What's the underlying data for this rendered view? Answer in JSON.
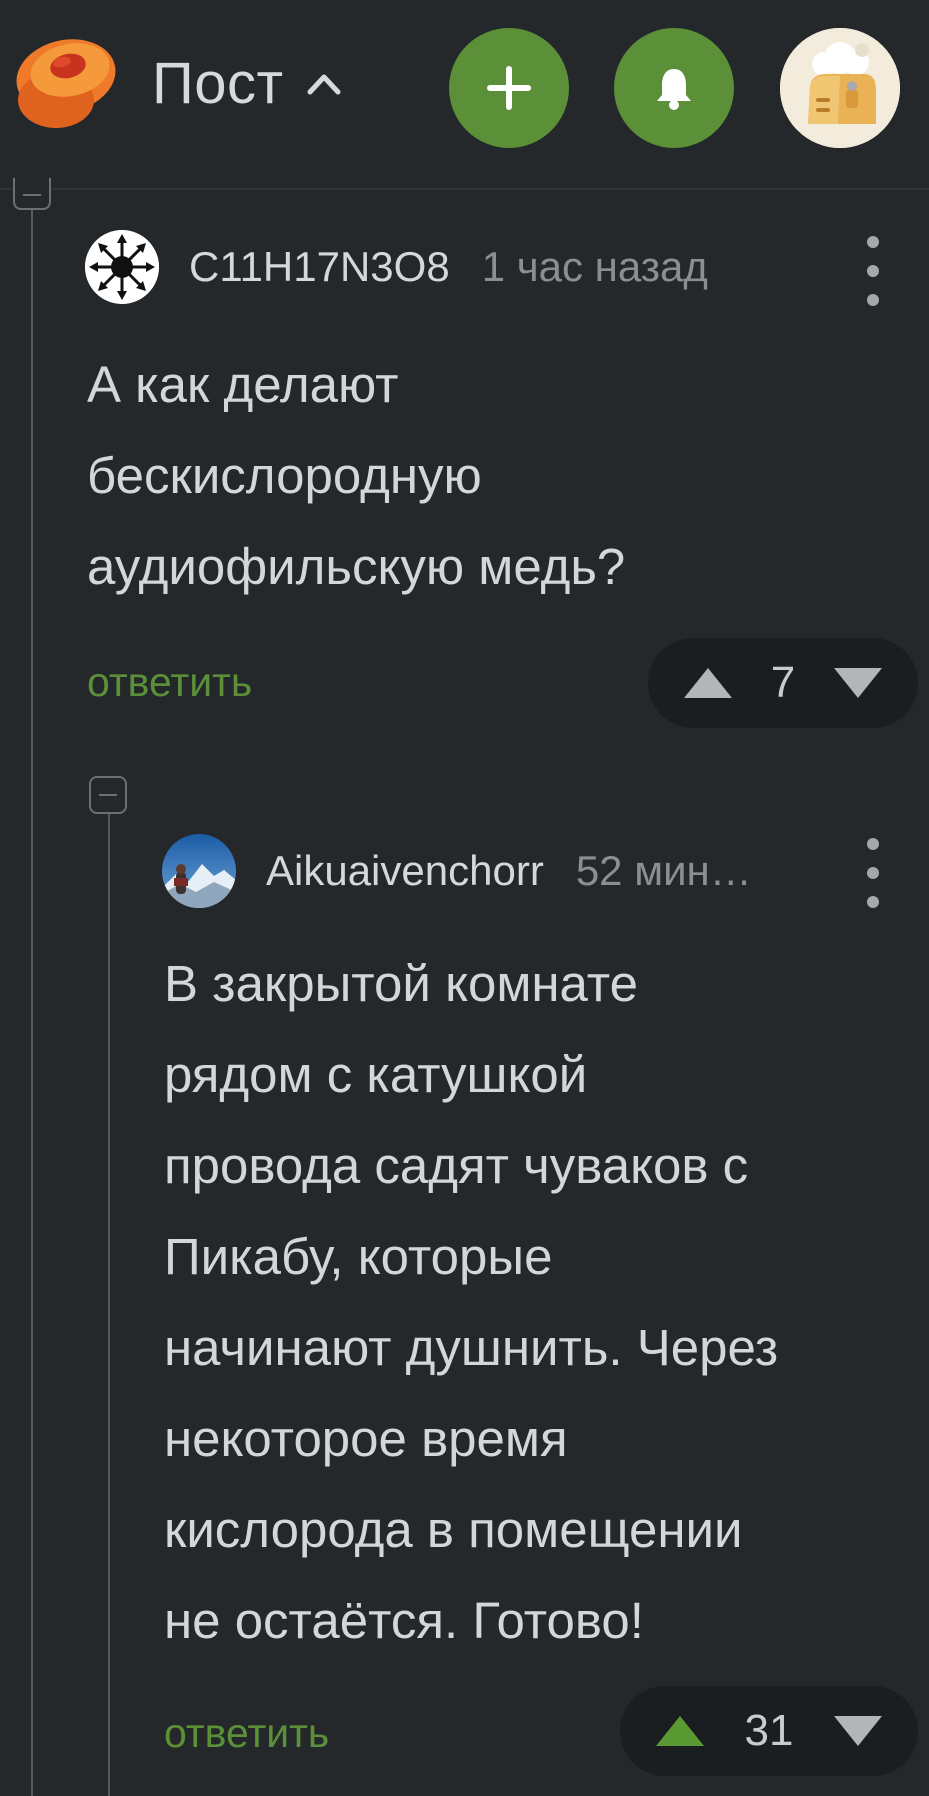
{
  "header": {
    "title": "Пост",
    "add_label": "add",
    "colors": {
      "background": "#24282b",
      "accent_green": "#5b8f38",
      "logo_orange": "#ee7a2a"
    }
  },
  "comments": [
    {
      "author": "C11H17N3O8",
      "time": "1 час назад",
      "text": "А как делают\nбескислородную\nаудиофильскую медь?",
      "reply_label": "ответить",
      "votes": "7",
      "avatar_icon": "chaos-star-icon"
    },
    {
      "author": "Aikuaivenchorr",
      "time": "52 мин…",
      "text": "В закрытой комнате\nрядом с катушкой\nпровода садят чуваков с\nПикабу, которые\nначинают душнить. Через\nнекоторое время\nкислорода в помещении\nне остаётся. Готово!",
      "reply_label": "ответить",
      "votes": "31",
      "upvoted": true,
      "avatar_icon": "mountain-photo-avatar"
    }
  ]
}
